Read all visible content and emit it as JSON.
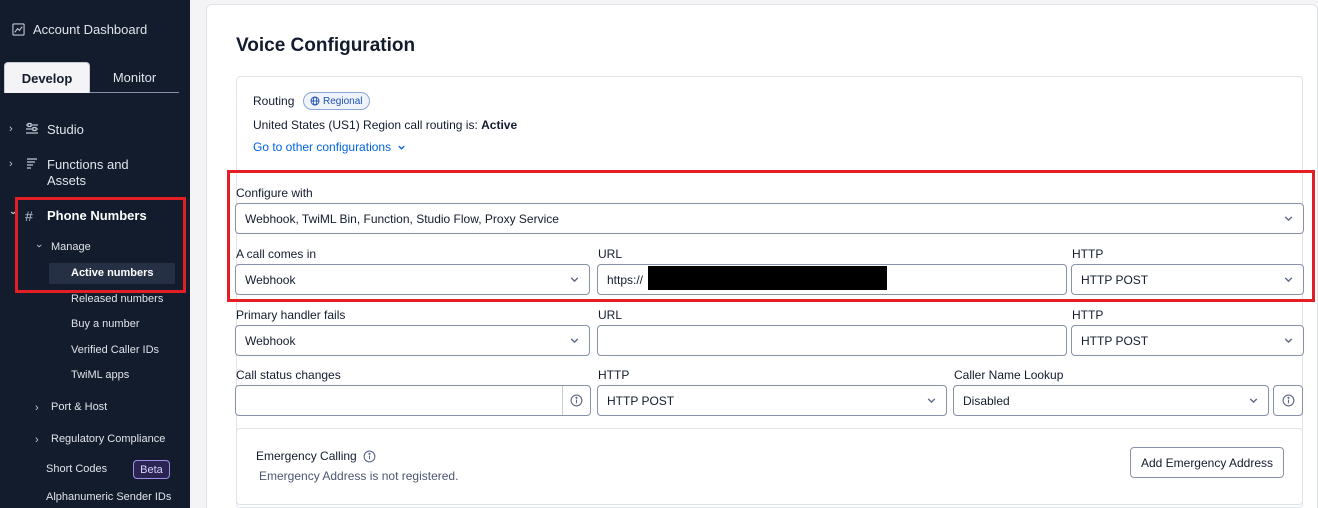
{
  "sidebar": {
    "dashboard_label": "Account Dashboard",
    "tabs": [
      {
        "label": "Develop",
        "active": true
      },
      {
        "label": "Monitor",
        "active": false
      }
    ],
    "items": [
      {
        "label": "Studio"
      },
      {
        "label_line1": "Functions and",
        "label_line2": "Assets"
      },
      {
        "label": "Phone Numbers"
      }
    ],
    "manage_label": "Manage",
    "subitems": [
      {
        "label": "Active numbers",
        "active": true
      },
      {
        "label": "Released numbers"
      },
      {
        "label": "Buy a number"
      },
      {
        "label": "Verified Caller IDs"
      },
      {
        "label": "TwiML apps"
      }
    ],
    "port_host_label": "Port & Host",
    "regulatory_label": "Regulatory Compliance",
    "short_codes_label": "Short Codes",
    "beta_label": "Beta",
    "alphanumeric_label": "Alphanumeric Sender IDs"
  },
  "main": {
    "title": "Voice Configuration",
    "routing": {
      "label": "Routing",
      "badge": "Regional",
      "status_text": "United States (US1) Region call routing is:",
      "status_value": "Active",
      "link": "Go to other configurations"
    },
    "configure_with": {
      "label": "Configure with",
      "value": "Webhook, TwiML Bin, Function, Studio Flow, Proxy Service"
    },
    "call_comes_in": {
      "label": "A call comes in",
      "value": "Webhook",
      "url_label": "URL",
      "url_value": "https://",
      "http_label": "HTTP",
      "http_value": "HTTP POST"
    },
    "primary_fails": {
      "label": "Primary handler fails",
      "value": "Webhook",
      "url_label": "URL",
      "url_value": "",
      "http_label": "HTTP",
      "http_value": "HTTP POST"
    },
    "status_changes": {
      "label": "Call status changes",
      "value": "",
      "http_label": "HTTP",
      "http_value": "HTTP POST",
      "caller_lookup_label": "Caller Name Lookup",
      "caller_lookup_value": "Disabled"
    },
    "emergency": {
      "title": "Emergency Calling",
      "subtitle": "Emergency Address is not registered.",
      "button": "Add Emergency Address"
    }
  },
  "colors": {
    "sidebar_bg": "#121c2d",
    "link": "#0263e0",
    "highlight": "#e31e24"
  }
}
